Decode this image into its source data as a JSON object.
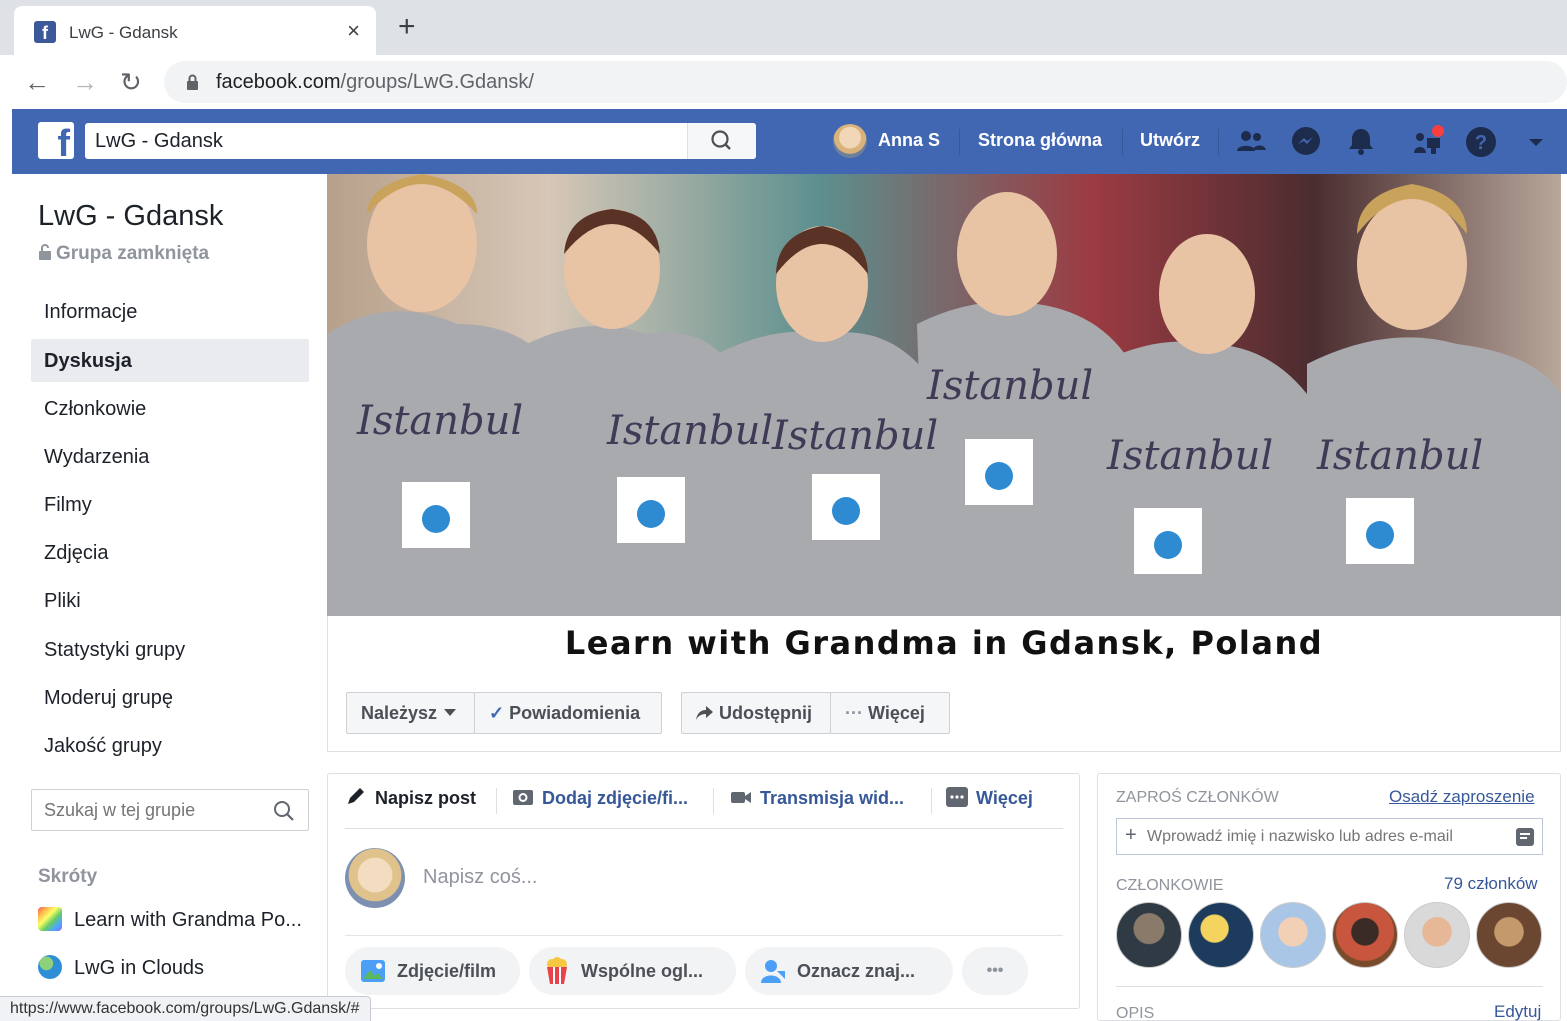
{
  "browser": {
    "tab_title": "LwG - Gdansk",
    "tab_close": "×",
    "new_tab": "+",
    "favicon": "f",
    "url_domain": "facebook.com",
    "url_path": "/groups/LwG.Gdansk/",
    "status_url": "https://www.facebook.com/groups/LwG.Gdansk/#"
  },
  "fb_header": {
    "logo": "f",
    "search_value": "LwG - Gdansk",
    "user_name": "Anna S",
    "home": "Strona główna",
    "create": "Utwórz",
    "brand_color": "#4267b2"
  },
  "sidebar": {
    "group_name": "LwG - Gdansk",
    "group_type": "Grupa zamknięta",
    "items": [
      {
        "label": "Informacje"
      },
      {
        "label": "Dyskusja",
        "active": true
      },
      {
        "label": "Członkowie"
      },
      {
        "label": "Wydarzenia"
      },
      {
        "label": "Filmy"
      },
      {
        "label": "Zdjęcia"
      },
      {
        "label": "Pliki"
      },
      {
        "label": "Statystyki grupy"
      },
      {
        "label": "Moderuj grupę"
      },
      {
        "label": "Jakość grupy"
      }
    ],
    "search_placeholder": "Szukaj w tej grupie",
    "shortcuts_heading": "Skróty",
    "shortcuts": [
      {
        "label": "Learn with Grandma Po..."
      },
      {
        "label": "LwG in Clouds"
      }
    ]
  },
  "cover": {
    "caption": "Learn with Grandma in Gdansk, Poland",
    "shirt_text": "Istanbul",
    "buttons": {
      "member": "Należysz",
      "notifications": "Powiadomienia",
      "share": "Udostępnij",
      "more": "Więcej"
    }
  },
  "composer": {
    "tabs": {
      "write": "Napisz post",
      "photo": "Dodaj zdjęcie/fi...",
      "live": "Transmisja wid...",
      "more": "Więcej"
    },
    "placeholder": "Napisz coś...",
    "actions": {
      "photo": "Zdjęcie/film",
      "watch": "Wspólne ogl...",
      "tag": "Oznacz znaj...",
      "more": "•••"
    }
  },
  "right": {
    "invite_heading": "ZAPROŚ CZŁONKÓW",
    "embed_link": "Osadź zaproszenie",
    "invite_placeholder": "Wprowadź imię i nazwisko lub adres e-mail",
    "members_heading": "CZŁONKOWIE",
    "members_count": "79 członków",
    "description_heading": "OPIS",
    "edit_link": "Edytuj"
  }
}
